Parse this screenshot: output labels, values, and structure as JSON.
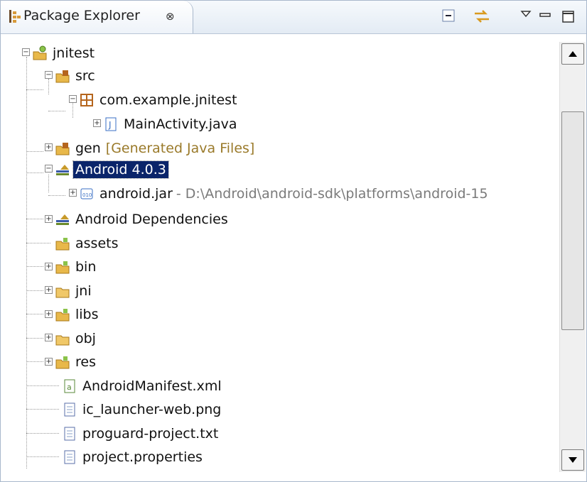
{
  "view": {
    "title": "Package Explorer",
    "close_glyph": "⊗"
  },
  "toolbar": {
    "collapse_all_icon": "collapse-all-icon",
    "link_with_editor_icon": "link-with-editor-icon",
    "view_menu_icon": "view-menu-icon",
    "minimize_icon": "minimize-icon",
    "maximize_icon": "maximize-icon"
  },
  "tree": {
    "project": "jnitest",
    "src": "src",
    "package": "com.example.jnitest",
    "main_activity": "MainActivity.java",
    "gen": "gen",
    "gen_decoration": "[Generated Java Files]",
    "android_lib": "Android 4.0.3",
    "android_jar": "android.jar",
    "android_jar_path": "- D:\\Android\\android-sdk\\platforms\\android-15",
    "android_dependencies": "Android Dependencies",
    "assets": "assets",
    "bin": "bin",
    "jni": "jni",
    "libs": "libs",
    "obj": "obj",
    "res": "res",
    "manifest": "AndroidManifest.xml",
    "launcher_png": "ic_launcher-web.png",
    "proguard": "proguard-project.txt",
    "project_properties": "project.properties"
  },
  "colors": {
    "selection": "#0a246a",
    "folder": "#e8b84a",
    "package": "#b5651d",
    "java": "#3a6fc4"
  }
}
